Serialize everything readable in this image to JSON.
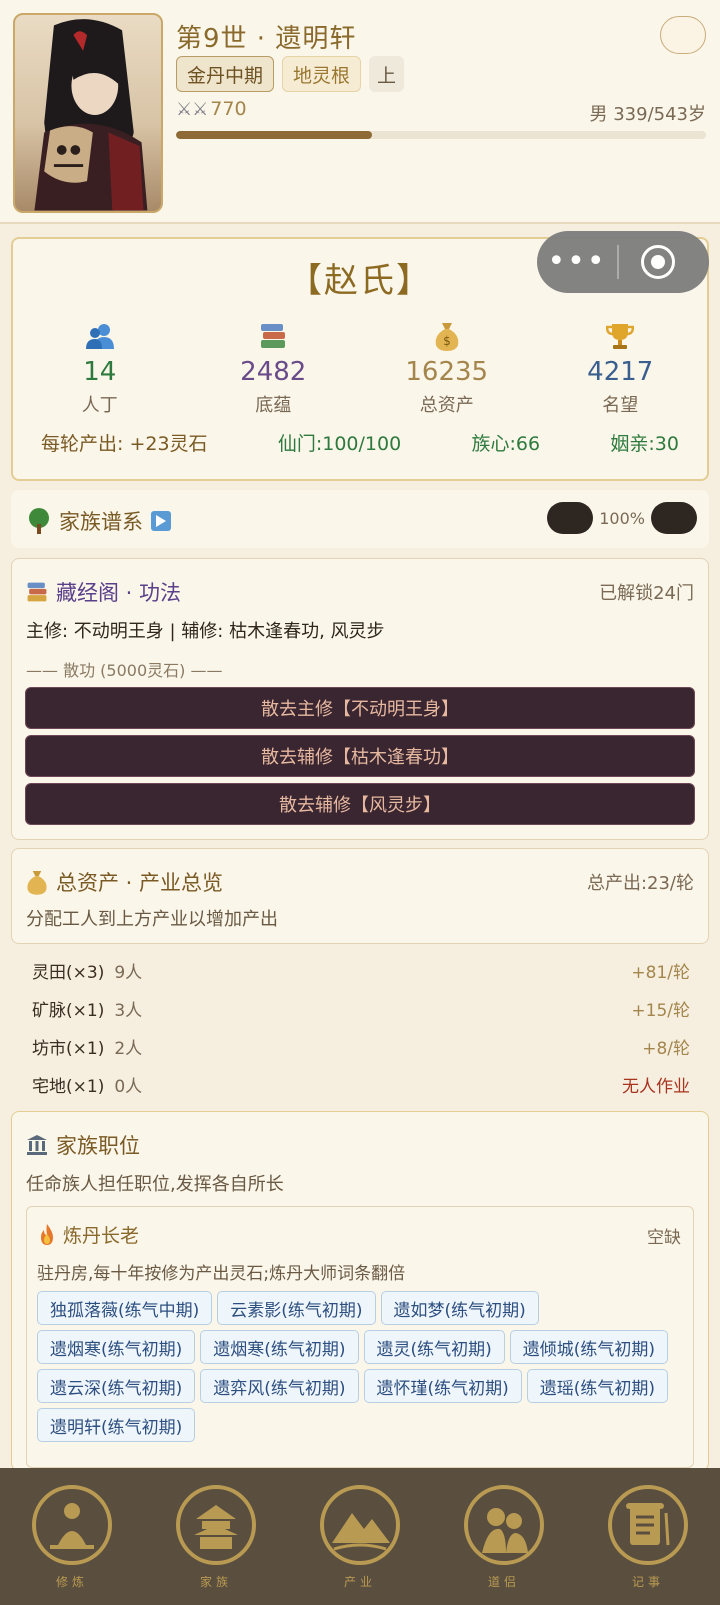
{
  "header": {
    "generation_title": "第9世 · 遗明轩",
    "settings_icon_glyph": "",
    "realm": "金丹中期",
    "spirit_root": "地灵根",
    "grade": "上",
    "power_icons": "⚔⚔",
    "power_value": "770",
    "age_text": "男 339/543岁",
    "age_progress": 0.37
  },
  "clan": {
    "name": "【赵氏】",
    "stats": [
      {
        "icon": "people-icon",
        "value": "14",
        "label": "人丁",
        "color": "#2e7a3e"
      },
      {
        "icon": "books-icon",
        "value": "2482",
        "label": "底蕴",
        "color": "#6a4b8a"
      },
      {
        "icon": "money-bag-icon",
        "value": "16235",
        "label": "总资产",
        "color": "#a4864c"
      },
      {
        "icon": "trophy-icon",
        "value": "4217",
        "label": "名望",
        "color": "#3a5f8f"
      }
    ],
    "footer": {
      "output": "每轮产出: +23灵石",
      "sect": "仙门:100/100",
      "cohesion": "族心:66",
      "marriage": "姻亲:30"
    }
  },
  "lineage": {
    "title": "家族谱系",
    "zoom": "100%"
  },
  "library": {
    "title": "藏经阁 · 功法",
    "unlocked": "已解锁24门",
    "cultivation": "主修: 不动明王身 | 辅修: 枯木逢春功, 风灵步",
    "disperse_label": "—— 散功 (5000灵石) ——",
    "buttons": [
      "散去主修【不动明王身】",
      "散去辅修【枯木逢春功】",
      "散去辅修【风灵步】"
    ]
  },
  "assets": {
    "title": "总资产 · 产业总览",
    "total_output": "总产出:23/轮",
    "subtitle": "分配工人到上方产业以增加产出",
    "industries": [
      {
        "name": "灵田(×3)",
        "workers": "9人",
        "output": "+81/轮",
        "idle": false
      },
      {
        "name": "矿脉(×1)",
        "workers": "3人",
        "output": "+15/轮",
        "idle": false
      },
      {
        "name": "坊市(×1)",
        "workers": "2人",
        "output": "+8/轮",
        "idle": false
      },
      {
        "name": "宅地(×1)",
        "workers": "0人",
        "output": "无人作业",
        "idle": true
      }
    ]
  },
  "positions": {
    "title": "家族职位",
    "subtitle": "任命族人担任职位,发挥各自所长",
    "role": {
      "title": "炼丹长老",
      "status": "空缺",
      "description": "驻丹房,每十年按修为产出灵石;炼丹大师词条翻倍",
      "candidates": [
        "独孤落薇(练气中期)",
        "云素影(练气初期)",
        "遗如梦(练气初期)",
        "遗烟寒(练气初期)",
        "遗烟寒(练气初期)",
        "遗灵(练气初期)",
        "遗倾城(练气初期)",
        "遗云深(练气初期)",
        "遗弈风(练气初期)",
        "遗怀瑾(练气初期)",
        "遗瑶(练气初期)",
        "遗明轩(练气初期)"
      ]
    }
  },
  "nav": [
    {
      "label": "修炼",
      "icon": "meditation-icon"
    },
    {
      "label": "家族",
      "icon": "pavilion-icon"
    },
    {
      "label": "产业",
      "icon": "mountain-icon"
    },
    {
      "label": "道侣",
      "icon": "couple-icon"
    },
    {
      "label": "记事",
      "icon": "scroll-icon"
    }
  ]
}
